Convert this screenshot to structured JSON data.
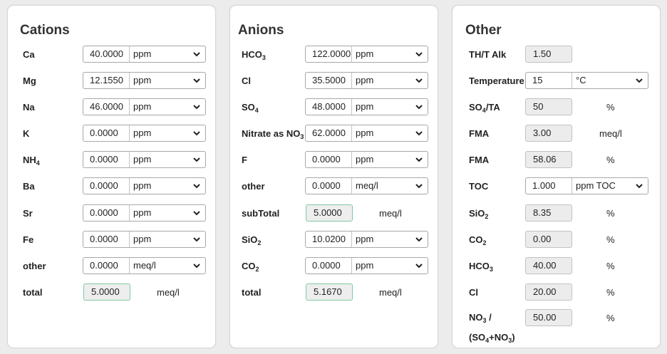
{
  "cations": {
    "title": "Cations",
    "rows": [
      {
        "label": "Ca",
        "value": "40.0000",
        "unit": "ppm"
      },
      {
        "label": "Mg",
        "value": "12.1550",
        "unit": "ppm"
      },
      {
        "label": "Na",
        "value": "46.0000",
        "unit": "ppm"
      },
      {
        "label": "K",
        "value": "0.0000",
        "unit": "ppm"
      },
      {
        "label": "NH",
        "label_sub": "4",
        "value": "0.0000",
        "unit": "ppm"
      },
      {
        "label": "Ba",
        "value": "0.0000",
        "unit": "ppm"
      },
      {
        "label": "Sr",
        "value": "0.0000",
        "unit": "ppm"
      },
      {
        "label": "Fe",
        "value": "0.0000",
        "unit": "ppm"
      },
      {
        "label": "other",
        "value": "0.0000",
        "unit": "meq/l"
      }
    ],
    "total": {
      "label": "total",
      "value": "5.0000",
      "unit": "meq/l"
    }
  },
  "anions": {
    "title": "Anions",
    "rows": [
      {
        "label": "HCO",
        "label_sub": "3",
        "value": "122.0000",
        "unit": "ppm"
      },
      {
        "label": "Cl",
        "value": "35.5000",
        "unit": "ppm"
      },
      {
        "label": "SO",
        "label_sub": "4",
        "value": "48.0000",
        "unit": "ppm"
      },
      {
        "label": "Nitrate as NO",
        "label_sub": "3",
        "value": "62.0000",
        "unit": "ppm"
      },
      {
        "label": "F",
        "value": "0.0000",
        "unit": "ppm"
      },
      {
        "label": "other",
        "value": "0.0000",
        "unit": "meq/l"
      }
    ],
    "subtotal": {
      "label": "subTotal",
      "value": "5.0000",
      "unit": "meq/l"
    },
    "rows2": [
      {
        "label": "SiO",
        "label_sub": "2",
        "value": "10.0200",
        "unit": "ppm"
      },
      {
        "label": "CO",
        "label_sub": "2",
        "value": "0.0000",
        "unit": "ppm"
      }
    ],
    "total": {
      "label": "total",
      "value": "5.1670",
      "unit": "meq/l"
    }
  },
  "other": {
    "title": "Other",
    "th_alk": {
      "label": "TH/T Alk",
      "value": "1.50"
    },
    "temperature": {
      "label": "Temperature",
      "value": "15",
      "unit": "°C"
    },
    "so4_ta": {
      "label": "SO",
      "label_sub": "4",
      "label_rest": "/TA",
      "value": "50",
      "unit": "%"
    },
    "fma1": {
      "label": "FMA",
      "value": "3.00",
      "unit": "meq/l"
    },
    "fma2": {
      "label": "FMA",
      "value": "58.06",
      "unit": "%"
    },
    "toc": {
      "label": "TOC",
      "value": "1.000",
      "unit": "ppm TOC"
    },
    "sio2": {
      "label": "SiO",
      "label_sub": "2",
      "value": "8.35",
      "unit": "%"
    },
    "co2": {
      "label": "CO",
      "label_sub": "2",
      "value": "0.00",
      "unit": "%"
    },
    "hco3": {
      "label": "HCO",
      "label_sub": "3",
      "value": "40.00",
      "unit": "%"
    },
    "cl": {
      "label": "Cl",
      "value": "20.00",
      "unit": "%"
    },
    "no3_ratio": {
      "label_a": "NO",
      "label_a_sub": "3",
      "label_a_rest": " /",
      "label_b": "(SO",
      "label_b_sub": "4",
      "label_b_rest": "+NO",
      "label_b_sub2": "3",
      "label_b_end": ")",
      "value": "50.00",
      "unit": "%"
    }
  },
  "icons": {
    "dropdown": "chevron-down-icon"
  }
}
